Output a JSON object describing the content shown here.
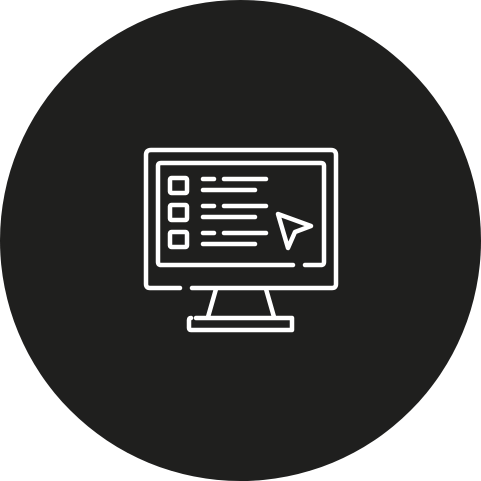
{
  "icon": {
    "name": "computer-monitor-checklist-cursor-icon",
    "background_color": "#1f1f1e",
    "line_color": "#ffffff",
    "page_background": "#ffffff"
  }
}
